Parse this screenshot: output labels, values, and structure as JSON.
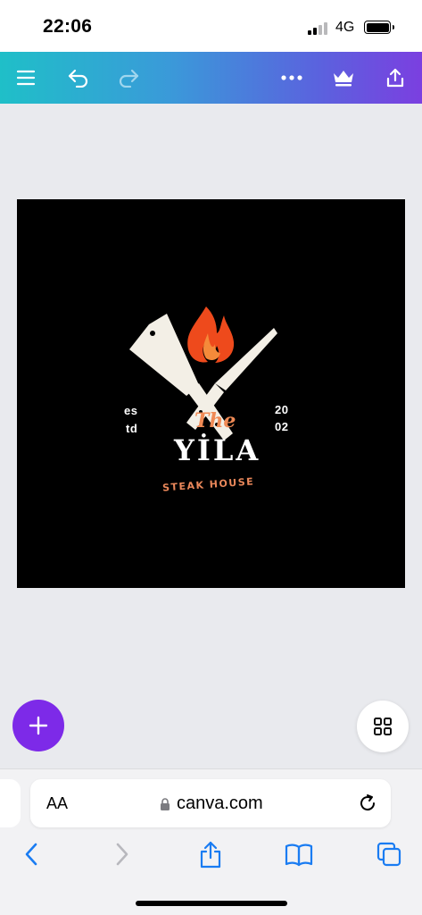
{
  "status_bar": {
    "time": "22:06",
    "network": "4G",
    "icons": [
      "signal-icon",
      "battery-icon"
    ]
  },
  "toolbar": {
    "icons": [
      "menu-icon",
      "undo-icon",
      "redo-icon",
      "more-icon",
      "crown-icon",
      "share-icon"
    ],
    "colors": {
      "gradient_start": "#1fbfc8",
      "gradient_end": "#7b3fe0"
    }
  },
  "design": {
    "est_left_1": "es",
    "est_left_2": "td",
    "est_right_1": "20",
    "est_right_2": "02",
    "the_text": "The",
    "brand_name": "YİLA",
    "subtitle": "STEAK HOUSE",
    "colors": {
      "background": "#000000",
      "accent": "#f08a55",
      "flame": "#ee4a1c"
    }
  },
  "floating": {
    "add_icon": "plus-icon",
    "grid_icon": "grid-icon",
    "add_color": "#7d2ae8"
  },
  "browser": {
    "text_size_label": "AA",
    "url": "canva.com",
    "icons": [
      "lock-icon",
      "reload-icon",
      "back-icon",
      "forward-icon",
      "share-icon",
      "bookmarks-icon",
      "tabs-icon"
    ],
    "accent": "#1a7cf2"
  }
}
